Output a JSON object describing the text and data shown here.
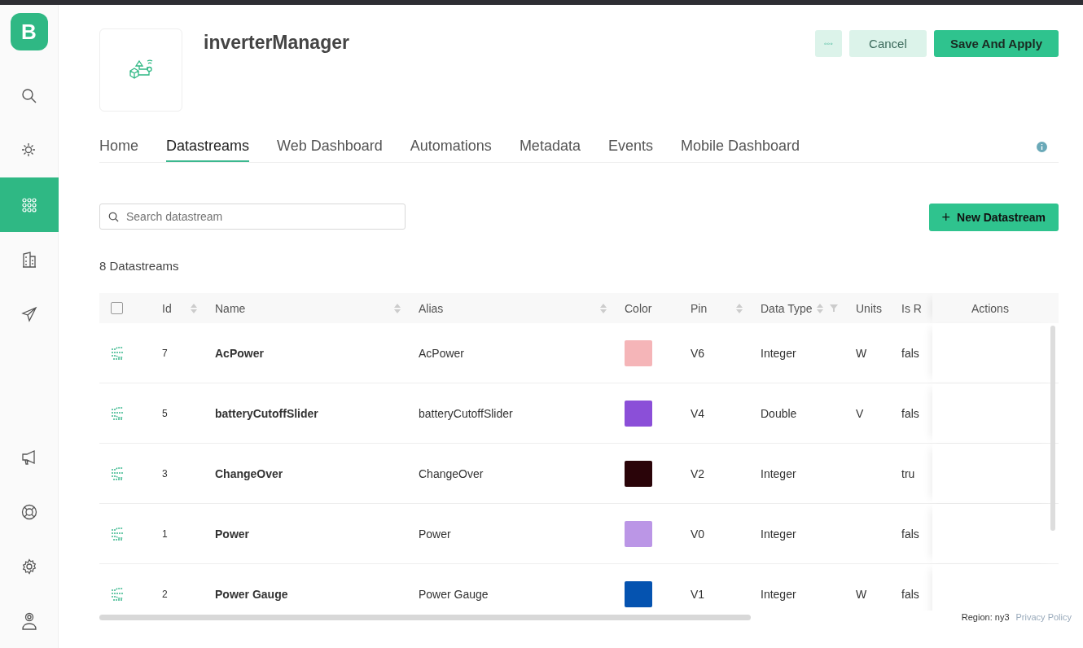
{
  "sidebar": {
    "logo": "B",
    "items": [
      {
        "kind": "search",
        "selected": false
      },
      {
        "kind": "sun",
        "selected": false
      },
      {
        "kind": "grid",
        "selected": true
      },
      {
        "kind": "building",
        "selected": false
      },
      {
        "kind": "send",
        "selected": false
      }
    ],
    "bottom_items": [
      {
        "kind": "megaphone",
        "selected": false
      },
      {
        "kind": "lifebuoy",
        "selected": false
      },
      {
        "kind": "gear",
        "selected": false
      },
      {
        "kind": "user",
        "selected": false
      }
    ]
  },
  "header": {
    "title": "inverterManager",
    "more_button": "◦◦◦",
    "buttons": [
      {
        "label": "Cancel",
        "kind": "secondary"
      },
      {
        "label": "Save And Apply",
        "kind": "primary"
      }
    ]
  },
  "tabs": [
    {
      "label": "Home",
      "selected": false
    },
    {
      "label": "Datastreams",
      "selected": true
    },
    {
      "label": "Web Dashboard",
      "selected": false
    },
    {
      "label": "Automations",
      "selected": false
    },
    {
      "label": "Metadata",
      "selected": false
    },
    {
      "label": "Events",
      "selected": false
    },
    {
      "label": "Mobile Dashboard",
      "selected": false
    }
  ],
  "search": {
    "placeholder": "Search datastream"
  },
  "new_button": {
    "icon": "+",
    "label": "New Datastream"
  },
  "count": "8 Datastreams",
  "table": {
    "select_all": {
      "checked": false
    },
    "columns": [
      {
        "label": "Id",
        "sortable": true,
        "filterable": false
      },
      {
        "label": "Name",
        "sortable": true,
        "filterable": false
      },
      {
        "label": "Alias",
        "sortable": true,
        "filterable": false
      },
      {
        "label": "Color",
        "sortable": false,
        "filterable": false
      },
      {
        "label": "Pin",
        "sortable": true,
        "filterable": false
      },
      {
        "label": "Data Type",
        "sortable": true,
        "filterable": true
      },
      {
        "label": "Units",
        "sortable": false,
        "filterable": false
      },
      {
        "label": "Is R",
        "sortable": false,
        "filterable": false
      },
      {
        "label": "Actions",
        "sortable": false,
        "filterable": false
      }
    ],
    "rows": [
      {
        "id": "7",
        "name": "AcPower",
        "alias": "AcPower",
        "color": "#f5b5b8",
        "pin": "V6",
        "data_type": "Integer",
        "units": "W",
        "is_r": "fals"
      },
      {
        "id": "5",
        "name": "batteryCutoffSlider",
        "alias": "batteryCutoffSlider",
        "color": "#8b4fd8",
        "pin": "V4",
        "data_type": "Double",
        "units": "V",
        "is_r": "fals"
      },
      {
        "id": "3",
        "name": "ChangeOver",
        "alias": "ChangeOver",
        "color": "#2a0409",
        "pin": "V2",
        "data_type": "Integer",
        "is_r": "tru"
      },
      {
        "id": "1",
        "name": "Power",
        "alias": "Power",
        "color": "#bb96e6",
        "pin": "V0",
        "data_type": "Integer",
        "is_r": "fals"
      },
      {
        "id": "2",
        "name": "Power Gauge",
        "alias": "Power Gauge",
        "color": "#0553b0",
        "pin": "V1",
        "data_type": "Integer",
        "units": "W",
        "is_r": "fals"
      }
    ]
  },
  "footer": {
    "region": "Region: ny3",
    "link": "Privacy Policy"
  }
}
